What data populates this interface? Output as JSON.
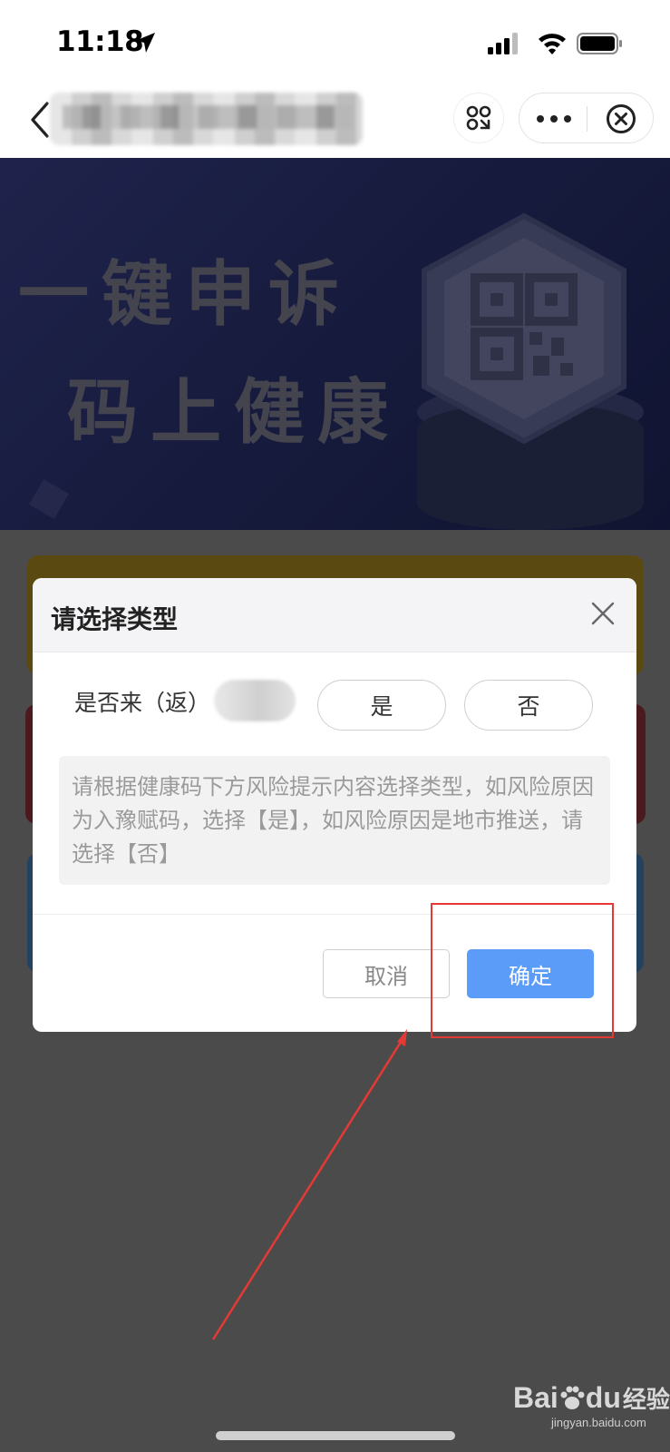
{
  "status_bar": {
    "time": "11:18"
  },
  "nav": {
    "title_blurred": true
  },
  "banner": {
    "line1": "一键申诉",
    "line2": "码上健康"
  },
  "modal": {
    "title": "请选择类型",
    "question_label": "是否来（返）",
    "option_yes": "是",
    "option_no": "否",
    "hint": "请根据健康码下方风险提示内容选择类型，如风险原因为入豫赋码，选择【是】，如风险原因是地市推送，请选择【否】",
    "cancel_label": "取消",
    "confirm_label": "确定"
  },
  "watermark": {
    "brand_a": "Bai",
    "brand_b": "du",
    "brand_c": "经验",
    "domain": "jingyan.baidu.com"
  },
  "colors": {
    "confirm_button": "#5a9cf8",
    "annotation": "#e53935",
    "overlay": "#4b4b4b"
  }
}
